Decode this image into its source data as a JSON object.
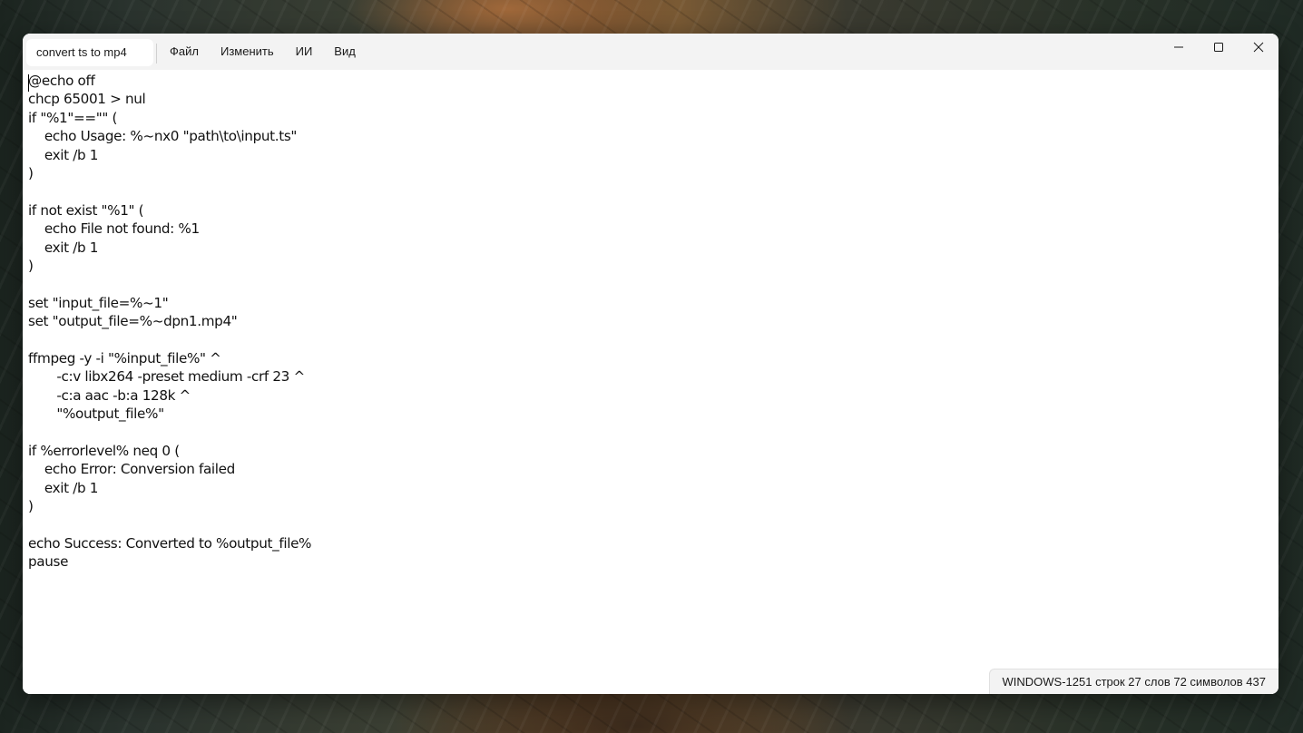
{
  "window": {
    "tab_title": "convert ts to mp4"
  },
  "menu": {
    "items": [
      "Файл",
      "Изменить",
      "ИИ",
      "Вид"
    ]
  },
  "controls": {
    "icons": [
      "minimize-icon",
      "maximize-icon",
      "close-icon"
    ]
  },
  "editor": {
    "lines": [
      "@echo off",
      "chcp 65001 > nul",
      "if \"%1\"==\"\" (",
      "    echo Usage: %~nx0 \"path\\to\\input.ts\"",
      "    exit /b 1",
      ")",
      "",
      "if not exist \"%1\" (",
      "    echo File not found: %1",
      "    exit /b 1",
      ")",
      "",
      "set \"input_file=%~1\"",
      "set \"output_file=%~dpn1.mp4\"",
      "",
      "ffmpeg -y -i \"%input_file%\" ^",
      "       -c:v libx264 -preset medium -crf 23 ^",
      "       -c:a aac -b:a 128k ^",
      "       \"%output_file%\"",
      "",
      "if %errorlevel% neq 0 (",
      "    echo Error: Conversion failed",
      "    exit /b 1",
      ")",
      "",
      "echo Success: Converted to %output_file%",
      "pause"
    ]
  },
  "status": {
    "text": "WINDOWS-1251  строк 27  слов 72  символов 437"
  }
}
